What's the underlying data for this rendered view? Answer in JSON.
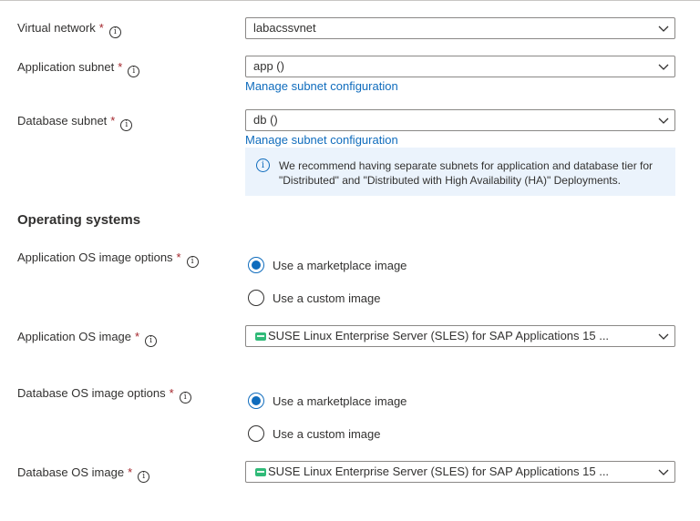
{
  "fields": {
    "virtual_network": {
      "label": "Virtual network",
      "required": "*",
      "value": "labacssvnet"
    },
    "application_subnet": {
      "label": "Application subnet",
      "required": "*",
      "value": "app ()",
      "link": "Manage subnet configuration"
    },
    "database_subnet": {
      "label": "Database subnet",
      "required": "*",
      "value": "db ()",
      "link": "Manage subnet configuration"
    }
  },
  "info_message": "We recommend having separate subnets for application and database tier for \"Distributed\" and \"Distributed with High Availability (HA)\" Deployments.",
  "operating_systems": {
    "title": "Operating systems",
    "app_os_options": {
      "label": "Application OS image options",
      "required": "*",
      "options": [
        "Use a marketplace image",
        "Use a custom image"
      ],
      "selected": "Use a marketplace image"
    },
    "app_os_image": {
      "label": "Application OS image",
      "required": "*",
      "value": "SUSE Linux Enterprise Server (SLES) for SAP Applications 15 ..."
    },
    "db_os_options": {
      "label": "Database OS image options",
      "required": "*",
      "options": [
        "Use a marketplace image",
        "Use a custom image"
      ],
      "selected": "Use a marketplace image"
    },
    "db_os_image": {
      "label": "Database OS image",
      "required": "*",
      "value": "SUSE Linux Enterprise Server (SLES) for SAP Applications 15 ..."
    }
  },
  "icons": {
    "info": "info-icon",
    "chevron": "chevron-down-icon",
    "os": "suse-icon"
  },
  "colors": {
    "accent": "#0f6cbd",
    "required": "#a4262c",
    "info_background": "#ebf3fc",
    "suse_green": "#30ba78"
  }
}
